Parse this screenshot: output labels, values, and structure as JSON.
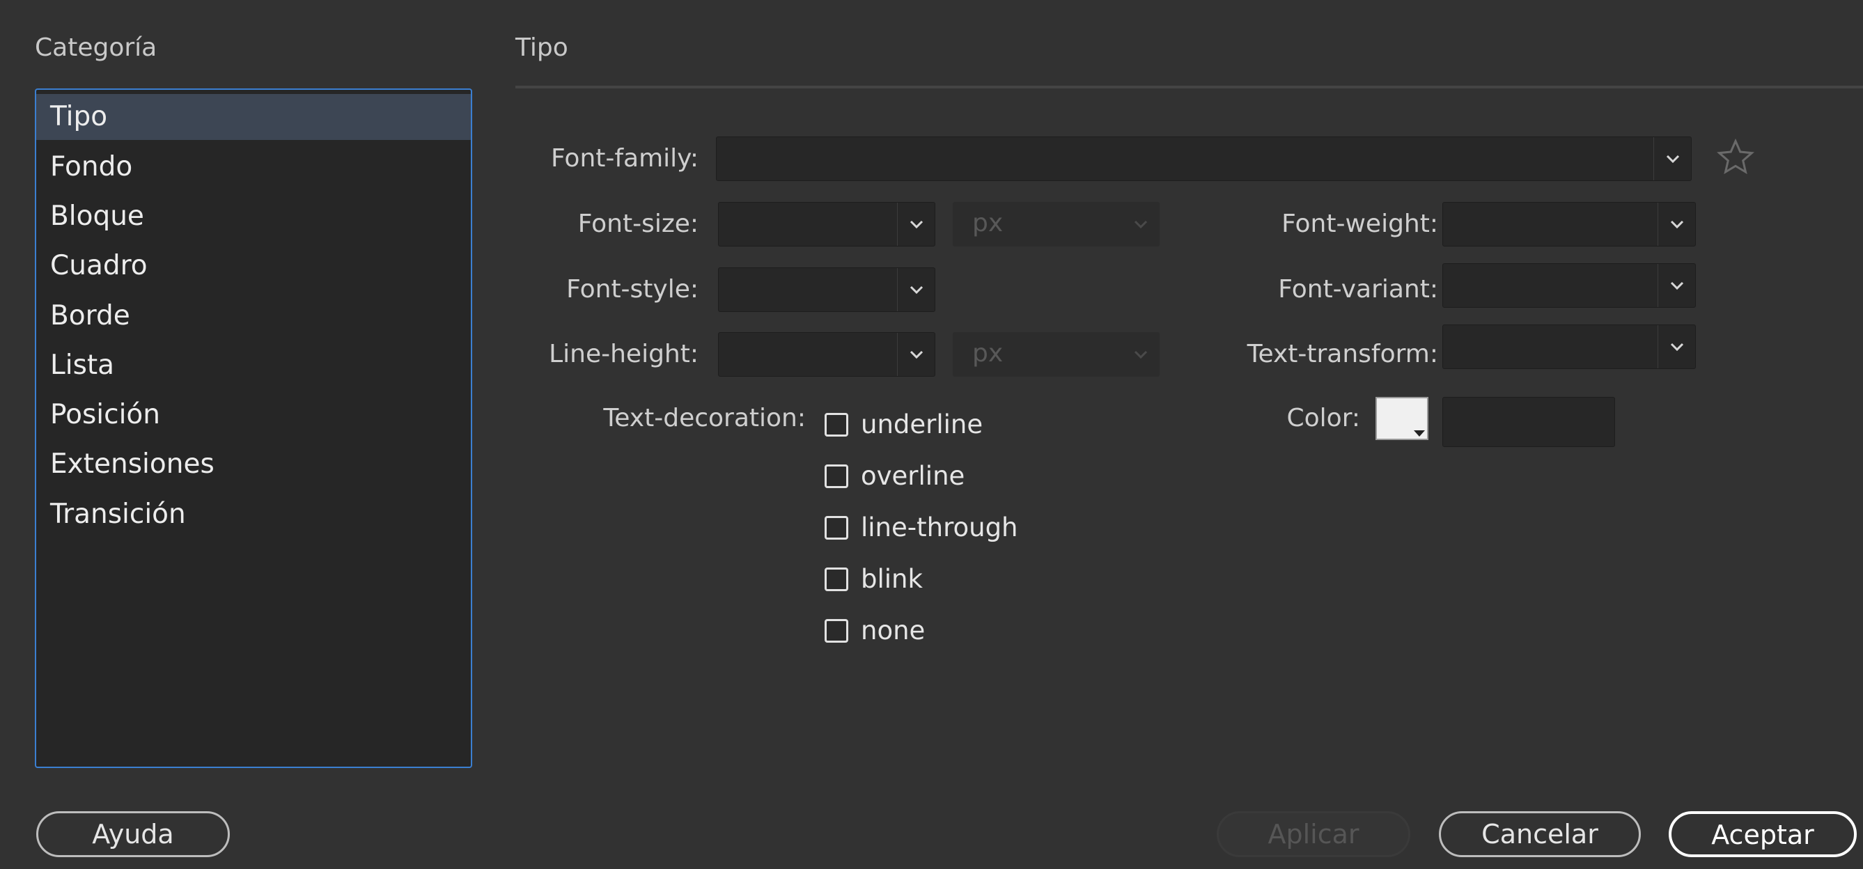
{
  "category": {
    "header": "Categoría",
    "items": [
      "Tipo",
      "Fondo",
      "Bloque",
      "Cuadro",
      "Borde",
      "Lista",
      "Posición",
      "Extensiones",
      "Transición"
    ],
    "selected": "Tipo"
  },
  "panel": {
    "header": "Tipo",
    "font_family": {
      "label": "Font-family:",
      "value": ""
    },
    "font_size": {
      "label": "Font-size:",
      "value": "",
      "unit": "px"
    },
    "font_weight": {
      "label": "Font-weight:",
      "value": ""
    },
    "font_style": {
      "label": "Font-style:",
      "value": ""
    },
    "font_variant": {
      "label": "Font-variant:",
      "value": ""
    },
    "line_height": {
      "label": "Line-height:",
      "value": "",
      "unit": "px"
    },
    "text_transform": {
      "label": "Text-transform:",
      "value": ""
    },
    "text_decoration": {
      "label": "Text-decoration:",
      "options": [
        "underline",
        "overline",
        "line-through",
        "blink",
        "none"
      ]
    },
    "color": {
      "label": "Color:",
      "value": "",
      "swatch": "#f0f0f0"
    }
  },
  "buttons": {
    "help": "Ayuda",
    "apply": "Aplicar",
    "cancel": "Cancelar",
    "ok": "Aceptar"
  },
  "icons": {
    "dropdown": "chevron-down-icon",
    "favorite": "star-icon"
  },
  "colors": {
    "selection": "#3d4654",
    "focus_border": "#3b7fd1"
  }
}
